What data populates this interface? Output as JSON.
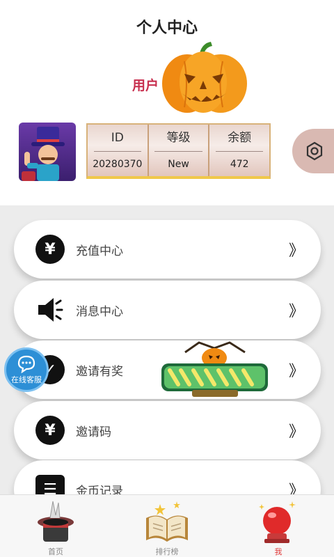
{
  "header": {
    "title": "个人中心",
    "username": "用户"
  },
  "stats": [
    {
      "label": "ID",
      "value": "20280370"
    },
    {
      "label": "等级",
      "value": "New"
    },
    {
      "label": "余额",
      "value": "472"
    }
  ],
  "menu": [
    {
      "label": "充值中心",
      "icon": "yen-icon"
    },
    {
      "label": "消息中心",
      "icon": "speaker-icon"
    },
    {
      "label": "邀请有奖",
      "icon": "gift-icon"
    },
    {
      "label": "邀请码",
      "icon": "yen-icon"
    },
    {
      "label": "金币记录",
      "icon": "list-icon"
    }
  ],
  "menu_arrow": "》",
  "service": {
    "label": "在线客服"
  },
  "tabs": [
    {
      "label": "首页",
      "icon": "magic-hat-icon"
    },
    {
      "label": "排行榜",
      "icon": "open-book-icon"
    },
    {
      "label": "我",
      "icon": "crystal-ball-icon"
    }
  ],
  "colors": {
    "username": "#c8304f",
    "active_tab": "#e03a3a",
    "content_bg": "#ececec",
    "stats_border": "#f0c84a"
  }
}
